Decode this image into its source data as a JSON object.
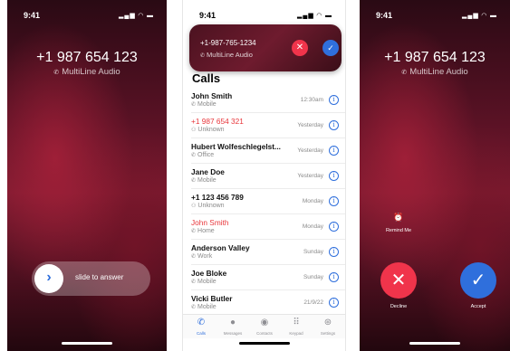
{
  "status_time": "9:41",
  "incoming": {
    "number": "+1 987 654 123",
    "line": "MultiLine Audio",
    "slide_label": "slide to answer"
  },
  "banner": {
    "number": "+1-987-765-1234",
    "line": "MultiLine Audio"
  },
  "calls": {
    "title": "Calls",
    "rows": [
      {
        "name": "John Smith",
        "type": "Mobile",
        "time": "12:30am",
        "missed": false
      },
      {
        "name": "+1 987 654 321",
        "type": "Unknown",
        "time": "Yesterday",
        "missed": true
      },
      {
        "name": "Hubert Wolfeschlegelst...",
        "type": "Office",
        "time": "Yesterday",
        "missed": false
      },
      {
        "name": "Jane Doe",
        "type": "Mobile",
        "time": "Yesterday",
        "missed": false
      },
      {
        "name": "+1 123 456 789",
        "type": "Unknown",
        "time": "Monday",
        "missed": false
      },
      {
        "name": "John Smith",
        "type": "Home",
        "time": "Monday",
        "missed": true
      },
      {
        "name": "Anderson Valley",
        "type": "Work",
        "time": "Sunday",
        "missed": false
      },
      {
        "name": "Joe Bloke",
        "type": "Mobile",
        "time": "Sunday",
        "missed": false
      },
      {
        "name": "Vicki Butler",
        "type": "Mobile",
        "time": "21/9/22",
        "missed": false
      }
    ]
  },
  "tabs": [
    "Calls",
    "Messages",
    "Contacts",
    "Keypad",
    "Settings"
  ],
  "actions": {
    "remind": "Remind Me",
    "decline": "Decline",
    "accept": "Accept"
  },
  "colors": {
    "accent": "#2f6fdc",
    "decline": "#f0344b",
    "missed": "#e8363b"
  }
}
